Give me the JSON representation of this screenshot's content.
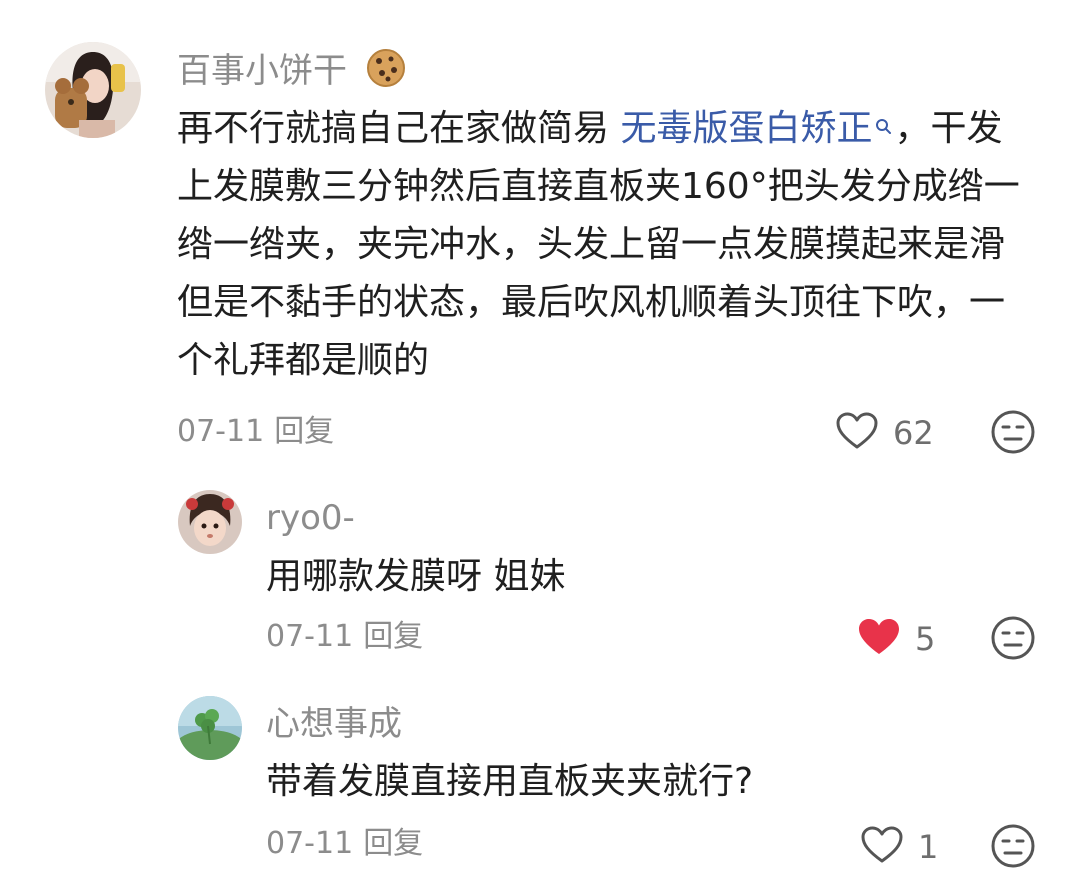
{
  "comment": {
    "username": "百事小饼干",
    "text_before_link": "再不行就搞自己在家做简易 ",
    "link_text": "无毒版蛋白矫正",
    "text_after_link": "，干发上发膜敷三分钟然后直接直板夹160°把头发分成绺一绺一绺夹，夹完冲水，头发上留一点发膜摸起来是滑但是不黏手的状态，最后吹风机顺着头顶往下吹，一个礼拜都是顺的",
    "date": "07-11",
    "reply_label": "回复",
    "likes": "62",
    "liked": false
  },
  "replies": [
    {
      "username": "ryo0-",
      "text": "用哪款发膜呀 姐妹",
      "date": "07-11",
      "reply_label": "回复",
      "likes": "5",
      "liked": true
    },
    {
      "username": "心想事成",
      "text": "带着发膜直接用直板夹夹就行?",
      "date": "07-11",
      "reply_label": "回复",
      "likes": "1",
      "liked": false
    }
  ],
  "colors": {
    "like_active": "#e8334a",
    "link": "#3a5ba8",
    "meta": "#8c8c8c"
  }
}
